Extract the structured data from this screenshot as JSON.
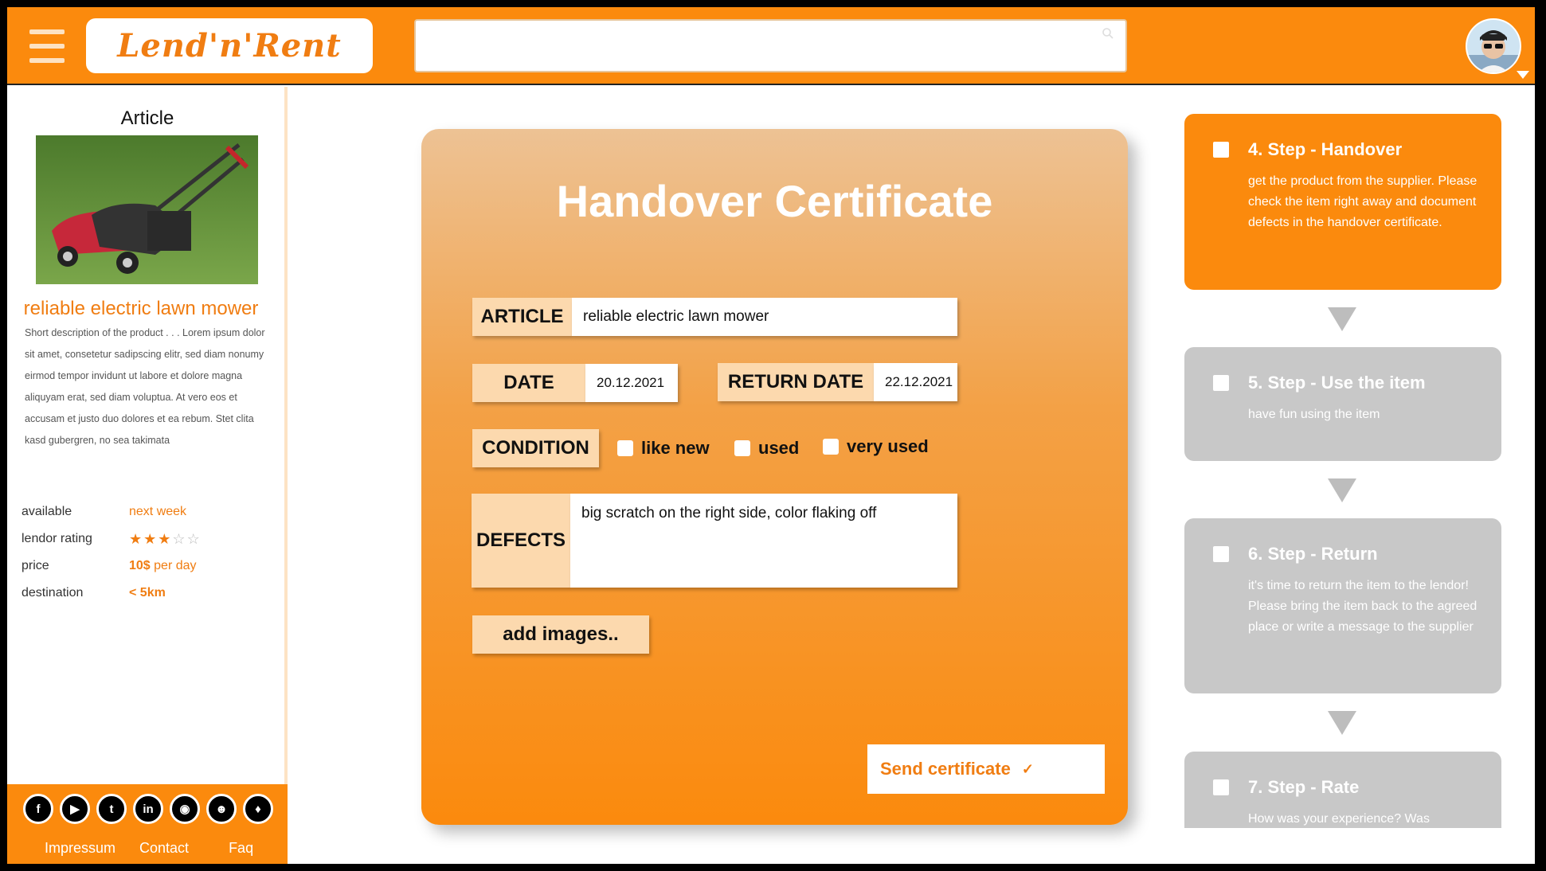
{
  "header": {
    "logo": "Lend'n'Rent",
    "search_placeholder": ""
  },
  "sidebar": {
    "title": "Article",
    "product_name": "reliable electric lawn mower",
    "description": "Short description of the product . . . Lorem ipsum dolor sit amet, consetetur sadipscing elitr, sed diam nonumy eirmod tempor invidunt ut labore et dolore magna aliquyam erat, sed diam voluptua. At vero eos et accusam et justo duo dolores et ea rebum. Stet clita kasd gubergren, no sea takimata",
    "info": {
      "available_label": "available",
      "available_value": "next week",
      "rating_label": "lendor rating",
      "rating_value": 3,
      "rating_max": 5,
      "price_label": "price",
      "price_amount": "10$",
      "price_unit": "per day",
      "destination_label": "destination",
      "destination_value": "< 5km"
    },
    "footer": {
      "social_icons": [
        "facebook-icon",
        "youtube-icon",
        "twitter-icon",
        "linkedin-icon",
        "instagram-icon",
        "reddit-icon",
        "snapchat-icon"
      ],
      "links": [
        "Impressum",
        "Contact",
        "Faq"
      ]
    }
  },
  "certificate": {
    "title": "Handover Certificate",
    "article_label": "ARTICLE",
    "article_value": "reliable electric lawn mower",
    "date_label": "DATE",
    "date_value": "20.12.2021",
    "return_date_label": "RETURN DATE",
    "return_date_value": "22.12.2021",
    "condition_label": "CONDITION",
    "condition_options": [
      "like new",
      "used",
      "very used"
    ],
    "defects_label": "DEFECTS",
    "defects_value": "big scratch on the right side, color flaking off",
    "add_images_label": "add images..",
    "send_label": "Send certificate",
    "send_icon": "check-icon"
  },
  "steps": [
    {
      "title": "4. Step - Handover",
      "desc": "get the product from the supplier. Please check the item right away and document defects in the handover certificate.",
      "state": "active"
    },
    {
      "title": "5. Step - Use the item",
      "desc": "have fun using the item",
      "state": "inactive"
    },
    {
      "title": "6. Step - Return",
      "desc": "it's time to return the item to the lendor! Please bring the item back to the agreed place or write a message to the supplier",
      "state": "inactive"
    },
    {
      "title": "7. Step - Rate",
      "desc": "How was your experience? Was",
      "state": "inactive"
    }
  ],
  "colors": {
    "brand_orange": "#fb8a0d",
    "accent_text": "#f07d12",
    "label_bg": "#fcd9ae",
    "inactive_step": "#c8c8c8"
  }
}
